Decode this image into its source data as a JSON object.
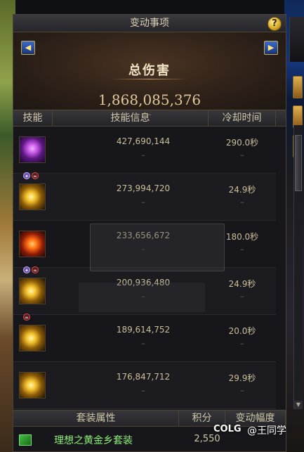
{
  "panel": {
    "title": "变动事项",
    "help_label": "?",
    "summary_title": "总伤害",
    "summary_value": "1,868,085,376",
    "summary_dash": "–",
    "prev_label": "◀",
    "next_label": "▶"
  },
  "columns": {
    "skill": "技能",
    "info": "技能信息",
    "cooldown": "冷却时间"
  },
  "rows": [
    {
      "damage": "427,690,144",
      "cooldown": "290.0秒",
      "dash": "–"
    },
    {
      "damage": "273,994,720",
      "cooldown": "24.9秒",
      "dash": "–"
    },
    {
      "damage": "233,656,672",
      "cooldown": "180.0秒",
      "dash": "–"
    },
    {
      "damage": "200,936,480",
      "cooldown": "24.9秒",
      "dash": "–"
    },
    {
      "damage": "189,614,752",
      "cooldown": "20.0秒",
      "dash": "–"
    },
    {
      "damage": "176,847,712",
      "cooldown": "29.9秒",
      "dash": "–"
    }
  ],
  "set_table": {
    "col_attr": "套装属性",
    "col_points": "积分",
    "col_change": "变动幅度",
    "name": "理想之黄金乡套装",
    "points": "2,550"
  },
  "watermark": {
    "brand": "COLG",
    "user": "@王同学"
  },
  "icons": [
    "purple-burst-icon",
    "gold-spark-icon",
    "fire-beast-icon",
    "gold-star-icon",
    "gold-cross-icon",
    "gold-flash-icon",
    "set-icon"
  ]
}
